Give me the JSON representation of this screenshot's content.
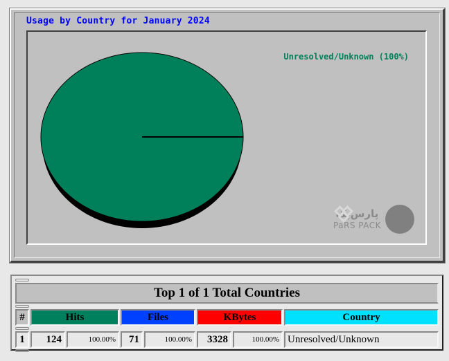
{
  "chart_data": {
    "type": "pie",
    "title": "Usage by Country for January 2024",
    "slices": [
      {
        "label": "Unresolved/Unknown",
        "value": 100,
        "percent_label": "(100%)",
        "color": "#00805a"
      }
    ],
    "legend": [
      "Unresolved/Unknown (100%)"
    ],
    "legend_position": "top-right",
    "shadow_color": "#000000"
  },
  "watermark": {
    "text_fa": "پارس‌پک",
    "text_en": "PaRS PACK"
  },
  "table": {
    "title": "Top 1 of 1 Total Countries",
    "headers": {
      "rank": "#",
      "hits": "Hits",
      "files": "Files",
      "kbytes": "KBytes",
      "country": "Country"
    },
    "header_colors": {
      "hits": "#00805c",
      "files": "#0040ff",
      "kbytes": "#ff0000",
      "country": "#00e0ff"
    },
    "rows": [
      {
        "rank": "1",
        "hits": "124",
        "hits_pct": "100.00%",
        "files": "71",
        "files_pct": "100.00%",
        "kbytes": "3328",
        "kbytes_pct": "100.00%",
        "country": "Unresolved/Unknown"
      }
    ]
  }
}
